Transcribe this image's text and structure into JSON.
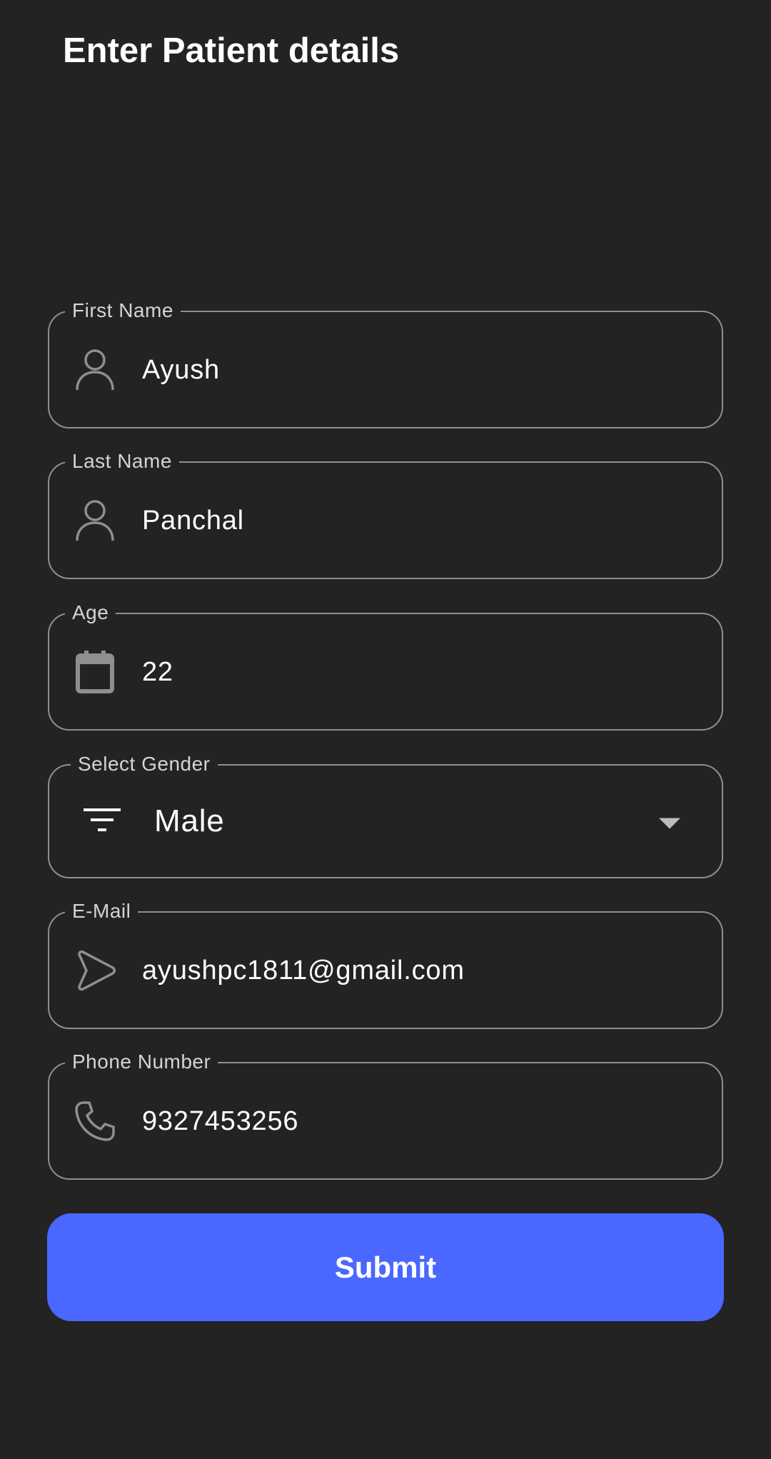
{
  "page": {
    "title": "Enter Patient details"
  },
  "form": {
    "first_name": {
      "label": "First Name",
      "value": "Ayush",
      "icon": "person-icon"
    },
    "last_name": {
      "label": "Last Name",
      "value": "Panchal",
      "icon": "person-icon"
    },
    "age": {
      "label": "Age",
      "value": "22",
      "icon": "calendar-icon"
    },
    "gender": {
      "label": "Select Gender",
      "value": "Male",
      "icon": "filter-icon"
    },
    "email": {
      "label": "E-Mail",
      "value": "ayushpc1811@gmail.com",
      "icon": "send-icon"
    },
    "phone": {
      "label": "Phone Number",
      "value": "9327453256",
      "icon": "phone-icon"
    }
  },
  "actions": {
    "submit_label": "Submit"
  },
  "colors": {
    "background": "#232323",
    "field_border": "#8f8f8f",
    "label_text": "#d4d4d4",
    "primary_button": "#4a67ff"
  }
}
